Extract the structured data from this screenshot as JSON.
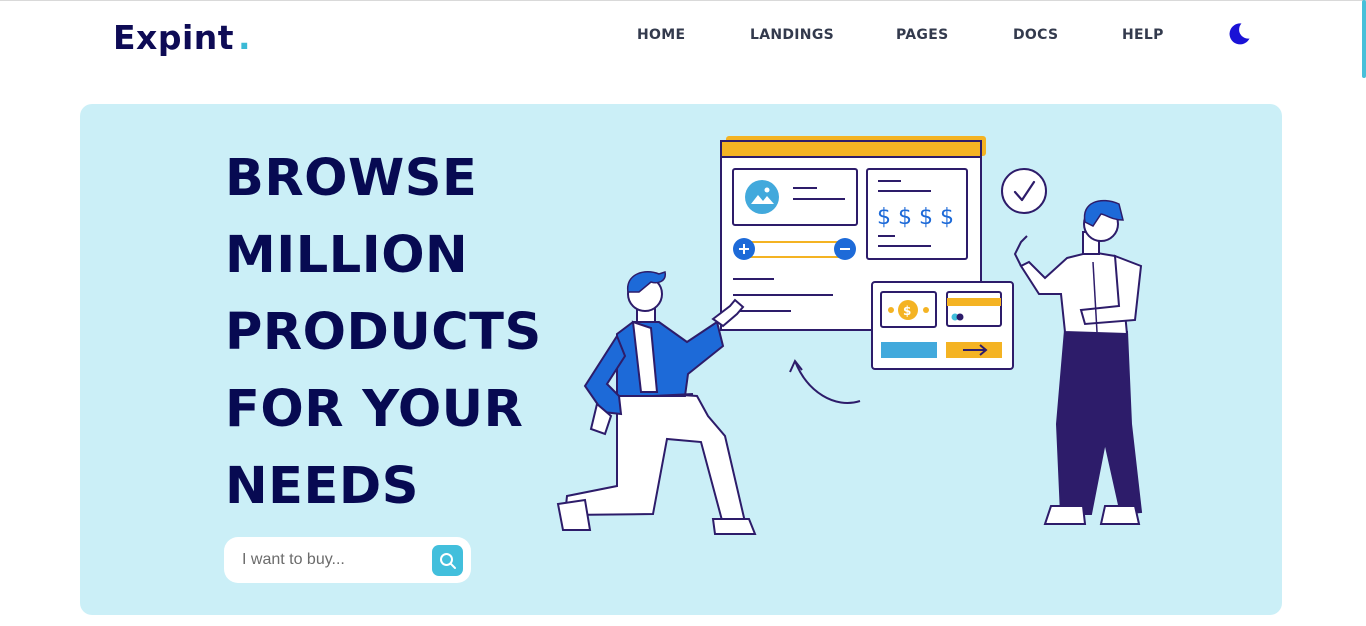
{
  "brand": {
    "name": "Expint",
    "dot": ".",
    "accent": "#3bbad6",
    "color": "#0e0b55"
  },
  "nav": {
    "items": [
      {
        "label": "HOME"
      },
      {
        "label": "LANDINGS"
      },
      {
        "label": "PAGES"
      },
      {
        "label": "DOCS"
      },
      {
        "label": "HELP"
      }
    ],
    "theme_toggle_icon": "moon-icon"
  },
  "hero": {
    "background": "#cbeff7",
    "headline_lines": [
      "BROWSE",
      "MILLION",
      "PRODUCTS",
      "FOR YOUR",
      "NEEDS"
    ],
    "search": {
      "placeholder": "I want to buy...",
      "value": "",
      "button_icon": "search-icon"
    },
    "illustration": {
      "card_dollars": "$ $ $ $",
      "bill_symbol": "$"
    }
  },
  "colors": {
    "navy": "#070a52",
    "accent_cyan": "#42bfdc",
    "accent_yellow": "#f4b323",
    "figure_blue": "#1d6ad8",
    "figure_purple": "#2d1c6a"
  }
}
